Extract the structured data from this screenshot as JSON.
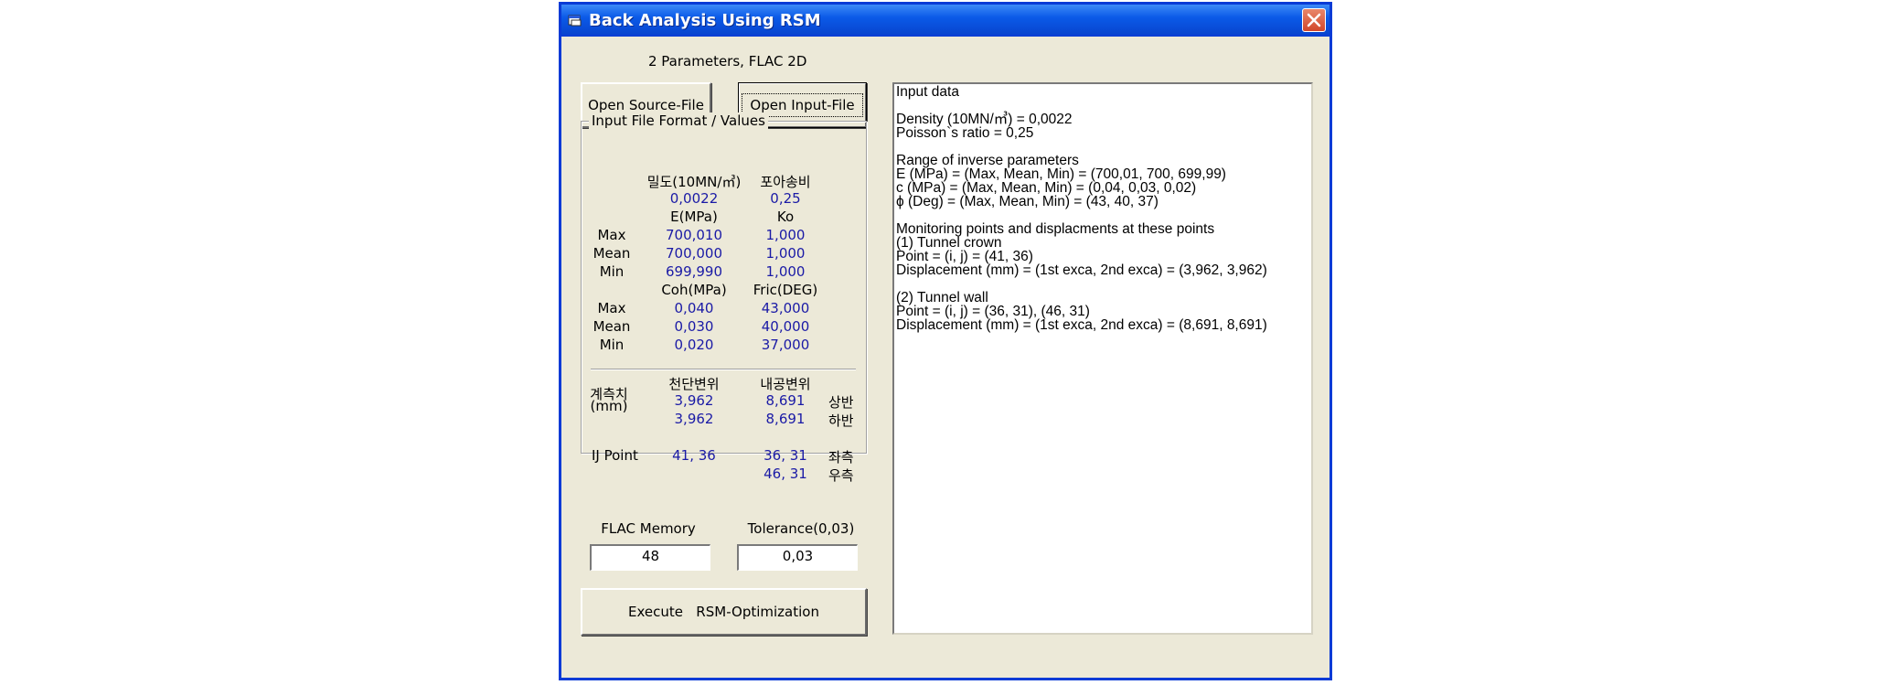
{
  "window": {
    "title": "Back Analysis Using RSM"
  },
  "subtitle": "2 Parameters, FLAC 2D",
  "buttons": {
    "open_source": "Open Source-File",
    "open_input": "Open Input-File",
    "execute": "Execute   RSM-Optimization"
  },
  "group": {
    "title": "Input File Format / Values",
    "density_header": "밀도(10MN/㎥)",
    "poisson_header": "포아송비",
    "density_value": "0,0022",
    "poisson_value": "0,25",
    "e_header": "E(MPa)",
    "ko_header": "Ko",
    "row_labels": [
      "Max",
      "Mean",
      "Min"
    ],
    "e_values": [
      "700,010",
      "700,000",
      "699,990"
    ],
    "ko_values": [
      "1,000",
      "1,000",
      "1,000"
    ],
    "coh_header": "Coh(MPa)",
    "fric_header": "Fric(DEG)",
    "coh_values": [
      "0,040",
      "0,030",
      "0,020"
    ],
    "fric_values": [
      "43,000",
      "40,000",
      "37,000"
    ],
    "measured_label": "계측치",
    "measured_unit": "(mm)",
    "crown_header": "천단변위",
    "wall_header": "내공변위",
    "crown_values": [
      "3,962",
      "3,962"
    ],
    "wall_values": [
      "8,691",
      "8,691"
    ],
    "stage_labels": [
      "상반",
      "하반"
    ],
    "ij_label": "IJ Point",
    "ij_crown": "41, 36",
    "ij_wall": [
      "36, 31",
      "46, 31"
    ],
    "side_labels": [
      "좌측",
      "우측"
    ]
  },
  "flac_memory": {
    "label": "FLAC Memory",
    "value": "48"
  },
  "tolerance": {
    "label": "Tolerance(0,03)",
    "value": "0,03"
  },
  "output_text": [
    "Input data",
    "",
    "Density (10MN/㎥) = 0,0022",
    "Poisson`s ratio = 0,25",
    "",
    "Range of inverse parameters",
    "E (MPa) = (Max, Mean, Min) = (700,01, 700, 699,99)",
    "c (MPa) = (Max, Mean, Min) = (0,04, 0,03, 0,02)",
    "ϕ (Deg) = (Max, Mean, Min) = (43, 40, 37)",
    "",
    "Monitoring points and displacments at these points",
    "(1) Tunnel crown",
    "Point = (i, j) = (41, 36)",
    "Displacement (mm) = (1st exca, 2nd exca) = (3,962, 3,962)",
    "",
    "(2) Tunnel wall",
    "Point = (i, j) = (36, 31), (46, 31)",
    "Displacement (mm) = (1st exca, 2nd exca) = (8,691, 8,691)"
  ]
}
